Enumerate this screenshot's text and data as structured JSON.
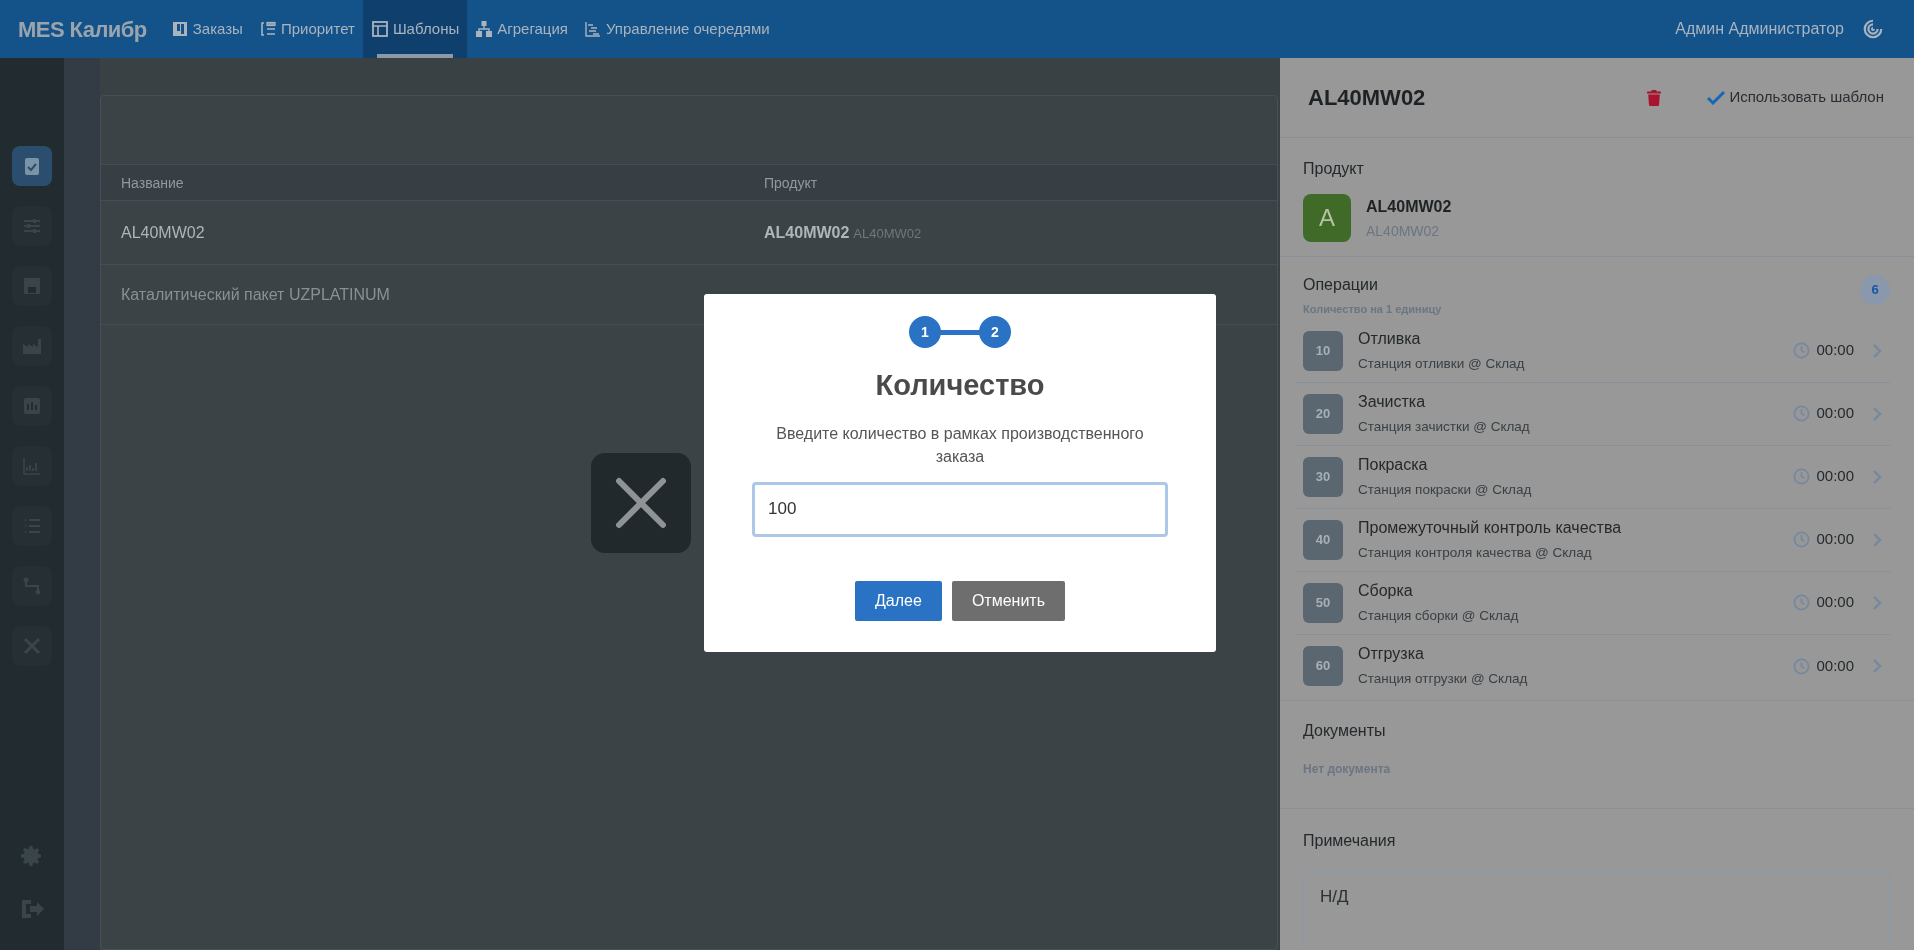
{
  "top_bar": {
    "logo": "MES Калибр",
    "nav": [
      {
        "label": "Заказы",
        "selected": false
      },
      {
        "label": "Приоритет",
        "selected": false
      },
      {
        "label": "Шаблоны",
        "selected": true
      },
      {
        "label": "Агрегация",
        "selected": false
      },
      {
        "label": "Управление очередями",
        "selected": false
      }
    ],
    "user": "Админ Администратор"
  },
  "sidebar": {
    "items": [
      {
        "selected": true
      },
      {
        "selected": false
      },
      {
        "selected": false
      },
      {
        "selected": false
      },
      {
        "selected": false
      },
      {
        "selected": false
      },
      {
        "selected": false
      },
      {
        "selected": false
      },
      {
        "selected": false
      }
    ]
  },
  "table": {
    "columns": [
      "Название",
      "Продукт"
    ],
    "rows": [
      {
        "name": "AL40MW02",
        "product": "AL40MW02",
        "product_code": "AL40MW02"
      },
      {
        "name": "Каталитический пакет UZPLATINUM"
      }
    ]
  },
  "detail_panel": {
    "title": "AL40MW02",
    "use_template": "Использовать шаблон",
    "product": {
      "heading": "Продукт",
      "avatar": "A",
      "name": "AL40MW02",
      "code": "AL40MW02"
    },
    "operations": {
      "heading": "Операции",
      "subtitle": "Количество на 1 единицу",
      "count": "6",
      "items": [
        {
          "number": "10",
          "name": "Отливка",
          "station": "Станция отливки @ Склад",
          "time": "00:00"
        },
        {
          "number": "20",
          "name": "Зачистка",
          "station": "Станция зачистки @ Склад",
          "time": "00:00"
        },
        {
          "number": "30",
          "name": "Покраска",
          "station": "Станция покраски @ Склад",
          "time": "00:00"
        },
        {
          "number": "40",
          "name": "Промежуточный контроль качества",
          "station": "Станция контроля качества @ Склад",
          "time": "00:00"
        },
        {
          "number": "50",
          "name": "Сборка",
          "station": "Станция сборки @ Склад",
          "time": "00:00"
        },
        {
          "number": "60",
          "name": "Отгрузка",
          "station": "Станция отгрузки @ Склад",
          "time": "00:00"
        }
      ]
    },
    "documents": {
      "heading": "Документы",
      "empty": "Нет документа"
    },
    "notes": {
      "heading": "Примечания",
      "value": "Н/Д"
    }
  },
  "dialog": {
    "steps": [
      "1",
      "2"
    ],
    "title": "Количество",
    "message": "Введите количество в рамках производственного заказа",
    "value": "100",
    "buttons": [
      {
        "label": "Далее",
        "kind": "primary"
      },
      {
        "label": "Отменить",
        "kind": "secondary"
      }
    ]
  }
}
